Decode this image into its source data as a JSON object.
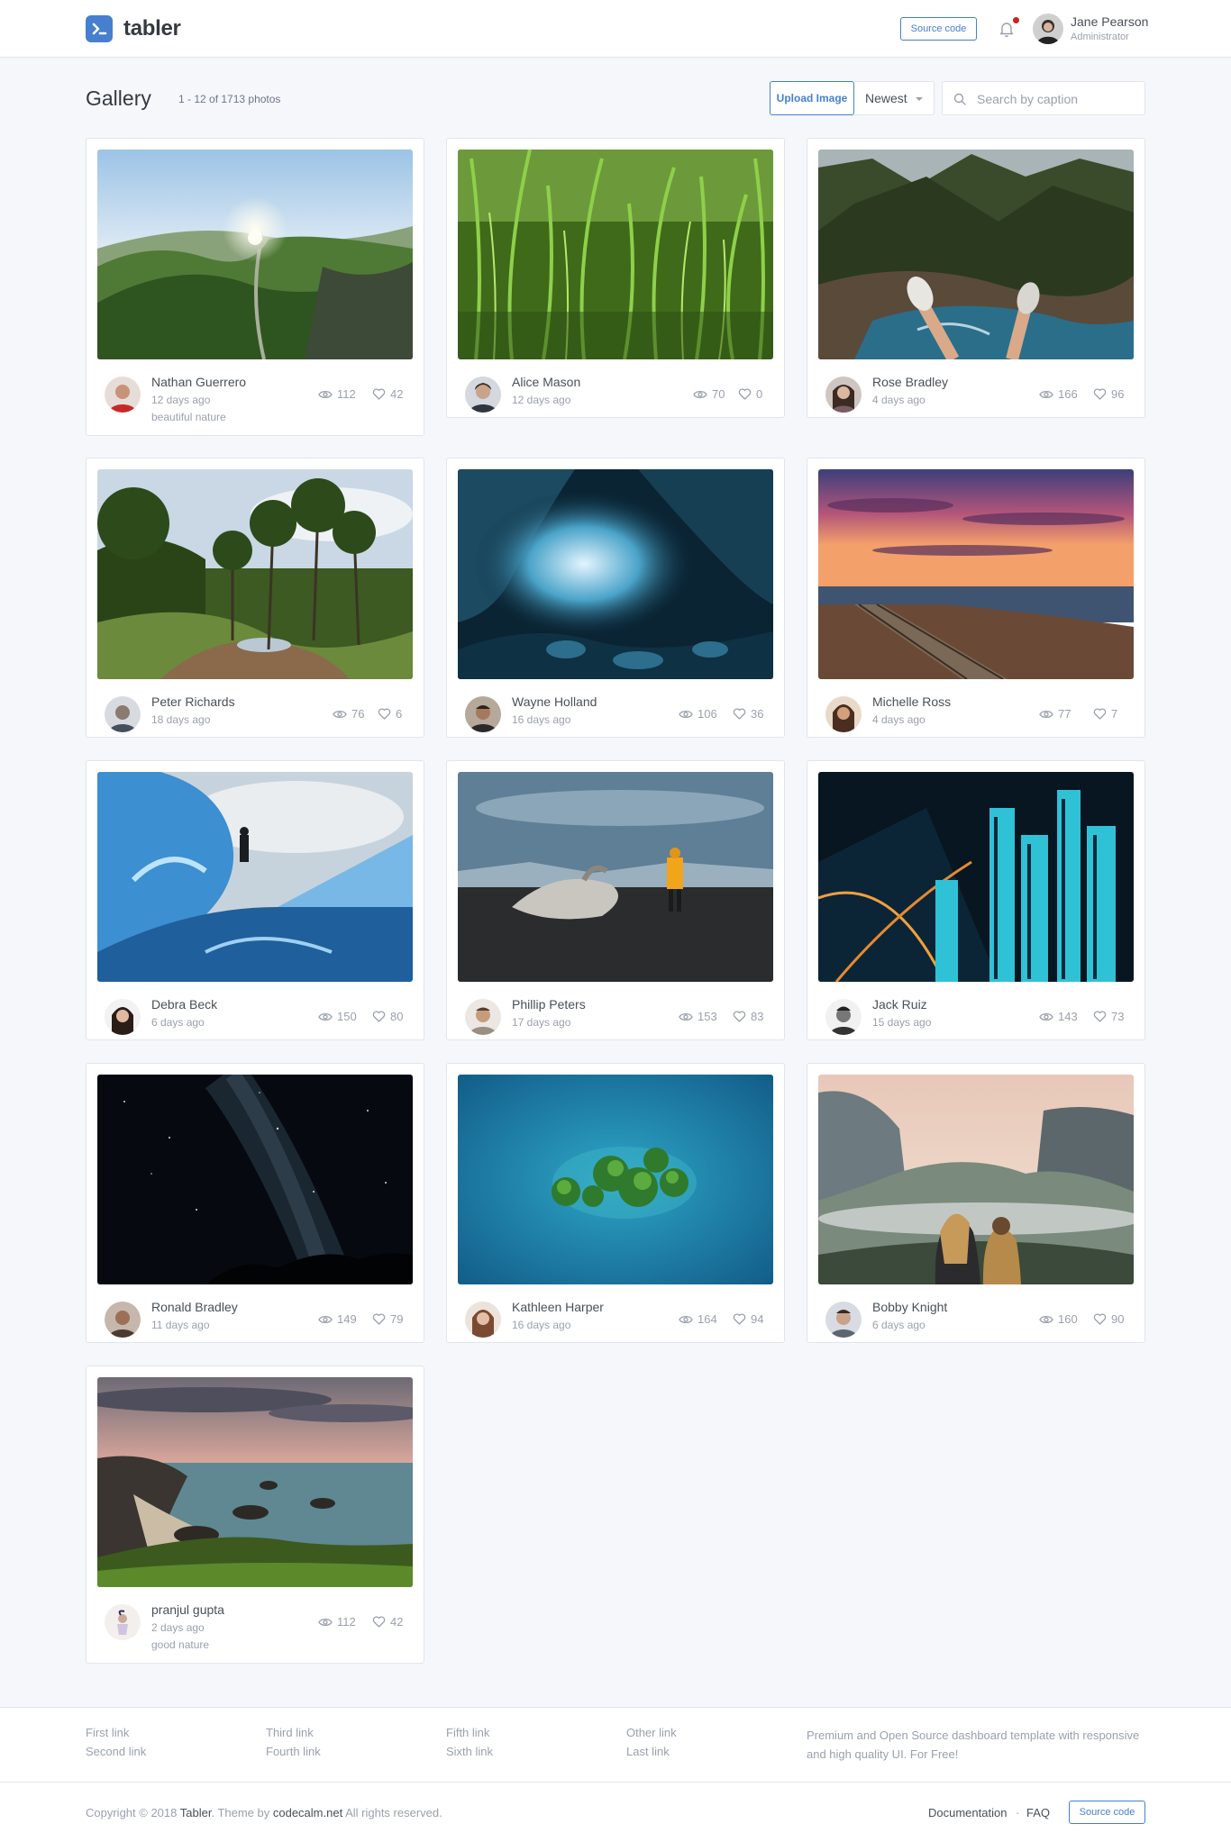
{
  "header": {
    "logo": "tabler",
    "source_code": "Source code",
    "user": {
      "name": "Jane Pearson",
      "role": "Administrator"
    }
  },
  "page": {
    "title": "Gallery",
    "count": "1 - 12 of 1713 photos",
    "upload": "Upload Image",
    "sort": "Newest",
    "search_placeholder": "Search by caption"
  },
  "cards": [
    {
      "name": "Nathan Guerrero",
      "time": "12 days ago",
      "caption": "beautiful nature",
      "views": "112",
      "likes": "42"
    },
    {
      "name": "Alice Mason",
      "time": "12 days ago",
      "caption": "",
      "views": "70",
      "likes": "0"
    },
    {
      "name": "Rose Bradley",
      "time": "4 days ago",
      "caption": "",
      "views": "166",
      "likes": "96"
    },
    {
      "name": "Peter Richards",
      "time": "18 days ago",
      "caption": "",
      "views": "76",
      "likes": "6"
    },
    {
      "name": "Wayne Holland",
      "time": "16 days ago",
      "caption": "",
      "views": "106",
      "likes": "36"
    },
    {
      "name": "Michelle Ross",
      "time": "4 days ago",
      "caption": "",
      "views": "77",
      "likes": "7"
    },
    {
      "name": "Debra Beck",
      "time": "6 days ago",
      "caption": "",
      "views": "150",
      "likes": "80"
    },
    {
      "name": "Phillip Peters",
      "time": "17 days ago",
      "caption": "",
      "views": "153",
      "likes": "83"
    },
    {
      "name": "Jack Ruiz",
      "time": "15 days ago",
      "caption": "",
      "views": "143",
      "likes": "73"
    },
    {
      "name": "Ronald Bradley",
      "time": "11 days ago",
      "caption": "",
      "views": "149",
      "likes": "79"
    },
    {
      "name": "Kathleen Harper",
      "time": "16 days ago",
      "caption": "",
      "views": "164",
      "likes": "94"
    },
    {
      "name": "Bobby Knight",
      "time": "6 days ago",
      "caption": "",
      "views": "160",
      "likes": "90"
    },
    {
      "name": "pranjul gupta",
      "time": "2 days ago",
      "caption": "good nature",
      "views": "112",
      "likes": "42"
    }
  ],
  "footer": {
    "links": [
      "First link",
      "Second link",
      "Third link",
      "Fourth link",
      "Fifth link",
      "Sixth link",
      "Other link",
      "Last link"
    ],
    "text": "Premium and Open Source dashboard template with responsive and high quality UI. For Free!",
    "copyright_pre": "Copyright © 2018 ",
    "brand": "Tabler",
    "copyright_mid": ". Theme by ",
    "author": "codecalm.net",
    "copyright_post": " All rights reserved.",
    "documentation": "Documentation",
    "sep": "·",
    "faq": "FAQ",
    "source_code": "Source code"
  },
  "colors": {
    "accent": "#467fcf",
    "notification": "#cd201f"
  }
}
